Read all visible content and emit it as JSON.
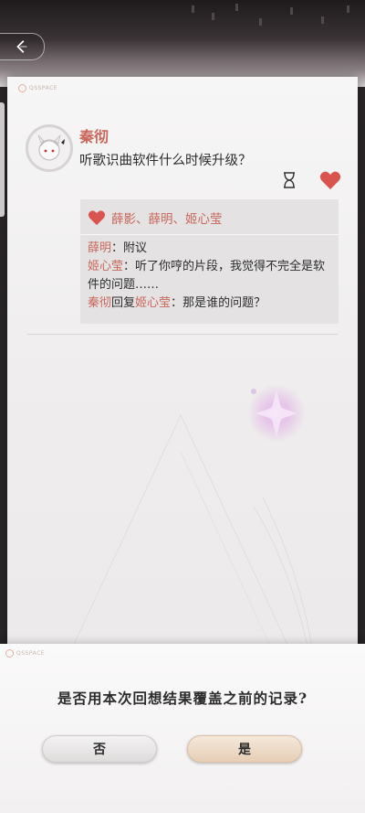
{
  "header": {
    "back_icon": "chevron-left-icon"
  },
  "card": {
    "brand": "QSSPACE",
    "post": {
      "author": "秦彻",
      "text": "听歌识曲软件什么时候升级？"
    },
    "likes": {
      "names": "薛影、薛明、姬心莹",
      "icon": "heart-icon",
      "color": "#d9534f"
    },
    "comments": [
      {
        "author": "薛明",
        "sep": "：",
        "text": "附议"
      },
      {
        "author": "姬心莹",
        "sep": "：",
        "text": "听了你哼的片段，我觉得不完全是软件的问题……"
      },
      {
        "author": "秦彻",
        "mid": "回复",
        "target": "姬心莹",
        "sep": "：",
        "text": "那是谁的问题？"
      }
    ]
  },
  "dialog": {
    "brand": "QSSPACE",
    "question": "是否用本次回想结果覆盖之前的记录?",
    "no_label": "否",
    "yes_label": "是"
  },
  "colors": {
    "accent": "#c8675a",
    "heart": "#d9534f"
  }
}
